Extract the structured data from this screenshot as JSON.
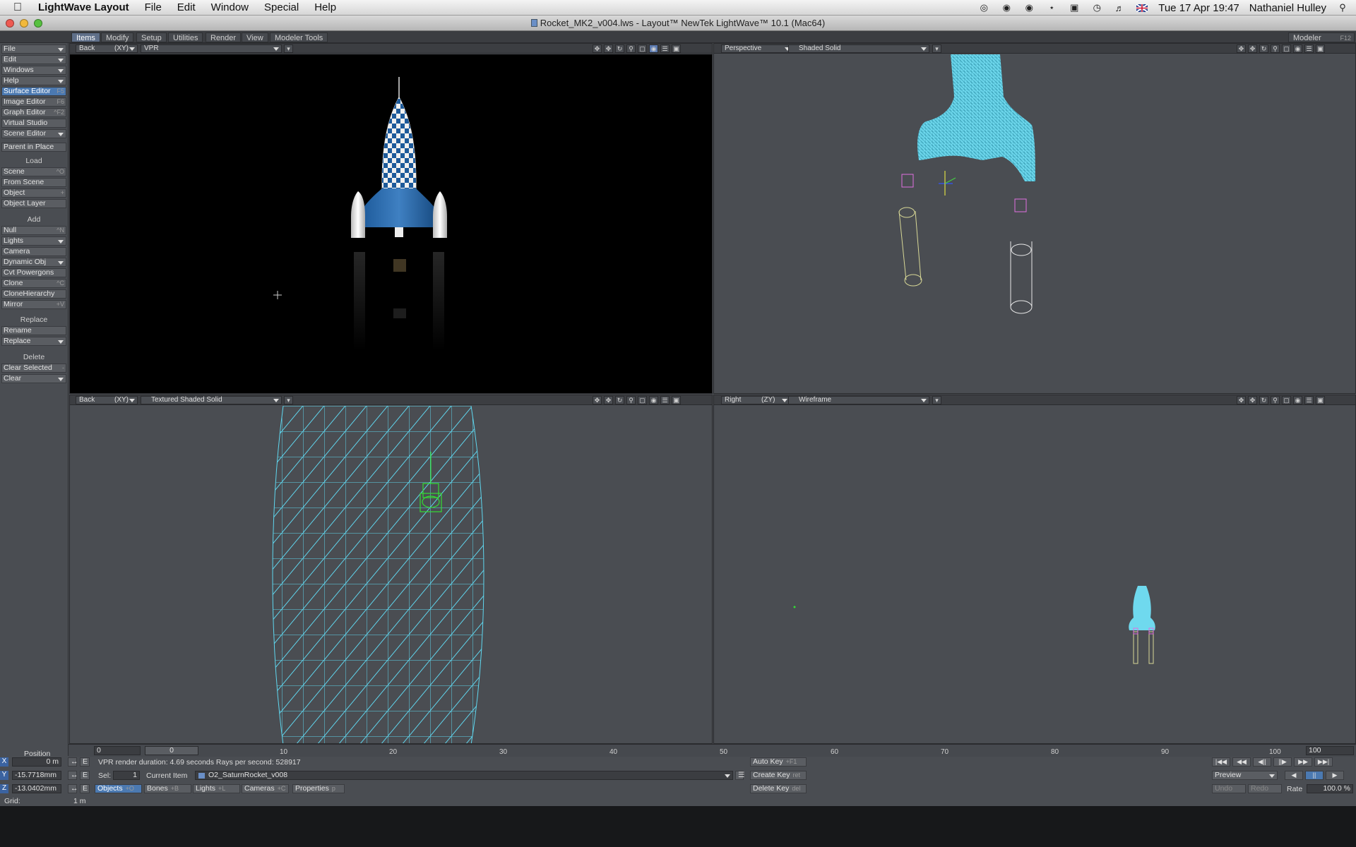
{
  "menubar": {
    "app_name": "LightWave Layout",
    "items": [
      "File",
      "Edit",
      "Window",
      "Special",
      "Help"
    ],
    "clock": "Tue 17 Apr  19:47",
    "user": "Nathaniel Hulley"
  },
  "window": {
    "title": "Rocket_MK2_v004.lws - Layout™ NewTek LightWave™ 10.1 (Mac64)"
  },
  "tabs": {
    "items": [
      "Items",
      "Modify",
      "Setup",
      "Utilities",
      "Render",
      "View",
      "Modeler Tools"
    ],
    "active": "Items",
    "modeler_label": "Modeler",
    "modeler_shortcut": "F12"
  },
  "left_toolbar": {
    "group1": [
      {
        "label": "File",
        "dropdown": true
      },
      {
        "label": "Edit",
        "dropdown": true
      },
      {
        "label": "Windows",
        "dropdown": true
      },
      {
        "label": "Help",
        "dropdown": true
      },
      {
        "label": "Surface Editor",
        "shortcut": "F5",
        "highlight": true
      },
      {
        "label": "Image Editor",
        "shortcut": "F6"
      },
      {
        "label": "Graph Editor",
        "shortcut": "^F2"
      },
      {
        "label": "Virtual Studio"
      },
      {
        "label": "Scene Editor",
        "dropdown": true
      }
    ],
    "parent_in_place": "Parent in Place",
    "load_header": "Load",
    "load": [
      {
        "label": "Scene",
        "shortcut": "^O"
      },
      {
        "label": "From Scene"
      },
      {
        "label": "Object",
        "shortcut": "+"
      },
      {
        "label": "Object Layer"
      }
    ],
    "add_header": "Add",
    "add": [
      {
        "label": "Null",
        "shortcut": "^N"
      },
      {
        "label": "Lights",
        "dropdown": true
      },
      {
        "label": "Camera"
      },
      {
        "label": "Dynamic Obj",
        "dropdown": true
      },
      {
        "label": "Cvt Powergons"
      },
      {
        "label": "Clone",
        "shortcut": "^C"
      },
      {
        "label": "CloneHierarchy"
      },
      {
        "label": "Mirror",
        "shortcut": "+V"
      }
    ],
    "replace_header": "Replace",
    "replace": [
      {
        "label": "Rename"
      },
      {
        "label": "Replace",
        "dropdown": true
      }
    ],
    "delete_header": "Delete",
    "delete": [
      {
        "label": "Clear Selected",
        "shortcut": "-"
      },
      {
        "label": "Clear",
        "dropdown": true
      }
    ]
  },
  "viewports": {
    "top_left": {
      "view": "Back",
      "axis": "(XY)",
      "mode": "VPR"
    },
    "top_right": {
      "view": "Perspective",
      "mode": "Shaded Solid"
    },
    "bottom_left": {
      "view": "Back",
      "axis": "(XY)",
      "mode": "Textured Shaded Solid"
    },
    "bottom_right": {
      "view": "Right",
      "axis": "(ZY)",
      "mode": "Wireframe"
    }
  },
  "timeline": {
    "start_value": "0",
    "current_frame": "0",
    "end_value": "100",
    "ticks": [
      "10",
      "20",
      "30",
      "40",
      "50",
      "60",
      "70",
      "80",
      "90",
      "100"
    ]
  },
  "bottom": {
    "position_label": "Position",
    "x_label": "X",
    "x_value": "0 m",
    "y_label": "Y",
    "y_value": "-15.7718mm",
    "z_label": "Z",
    "z_value": "-13.0402mm",
    "e_label": "E",
    "grid_label": "Grid:",
    "grid_value": "1 m",
    "status": "VPR render duration: 4.69 seconds   Rays per second: 528917",
    "sel_label": "Sel:",
    "sel_value": "1",
    "current_item_label": "Current Item",
    "current_item": "O2_SaturnRocket_v008",
    "edit_tabs": [
      {
        "label": "Objects",
        "shortcut": "+O",
        "active": true
      },
      {
        "label": "Bones",
        "shortcut": "+B"
      },
      {
        "label": "Lights",
        "shortcut": "+L"
      },
      {
        "label": "Cameras",
        "shortcut": "+C"
      }
    ],
    "properties_label": "Properties",
    "properties_shortcut": "p",
    "auto_key": "Auto Key",
    "auto_key_shortcut": "+F1",
    "create_key": "Create Key",
    "create_key_shortcut": "ret",
    "delete_key": "Delete Key",
    "delete_key_shortcut": "del",
    "preview_label": "Preview",
    "undo": "Undo",
    "redo": "Redo",
    "rate_label": "Rate",
    "rate_value": "100.0 %"
  }
}
